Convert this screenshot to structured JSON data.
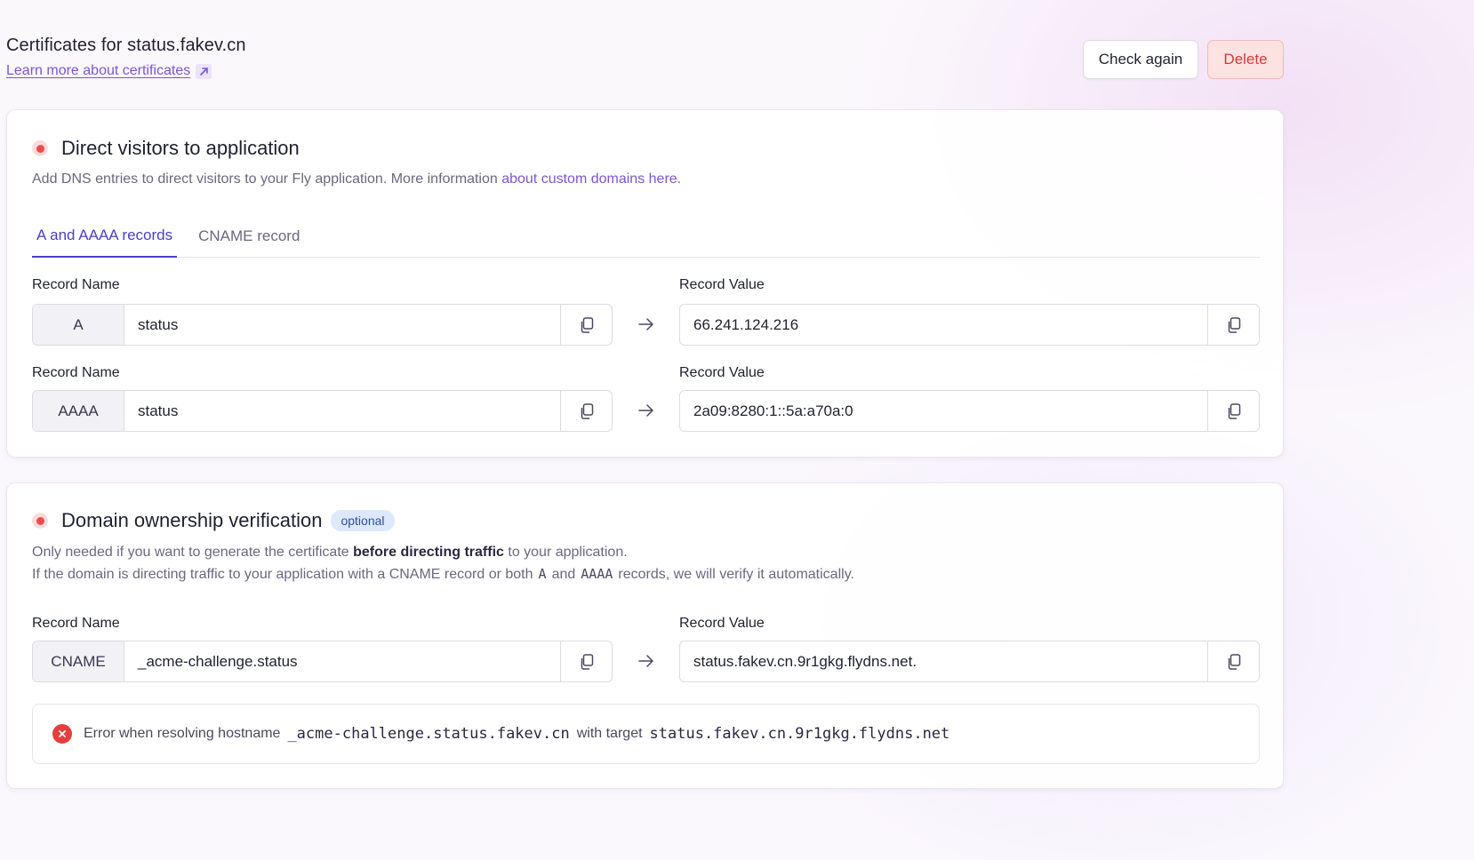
{
  "header": {
    "title": "Certificates for status.fakev.cn",
    "learn_more": "Learn more about certificates",
    "check_again": "Check again",
    "delete": "Delete"
  },
  "direct": {
    "title": "Direct visitors to application",
    "desc_prefix": "Add DNS entries to direct visitors to your Fly application. More information ",
    "desc_link": "about custom domains here",
    "desc_suffix": ".",
    "tabs": [
      {
        "label": "A and AAAA records",
        "active": true
      },
      {
        "label": "CNAME record",
        "active": false
      }
    ],
    "records": [
      {
        "name_label": "Record Name",
        "type": "A",
        "name": "status",
        "value_label": "Record Value",
        "value": "66.241.124.216"
      },
      {
        "name_label": "Record Name",
        "type": "AAAA",
        "name": "status",
        "value_label": "Record Value",
        "value": "2a09:8280:1::5a:a70a:0"
      }
    ]
  },
  "ownership": {
    "title": "Domain ownership verification",
    "badge": "optional",
    "line1_prefix": "Only needed if you want to generate the certificate ",
    "line1_bold": "before directing traffic",
    "line1_suffix": " to your application.",
    "line2_prefix": "If the domain is directing traffic to your application with a CNAME record or both",
    "line2_code1": "A",
    "line2_and": "and",
    "line2_code2": "AAAA",
    "line2_suffix": "records, we will verify it automatically.",
    "record": {
      "name_label": "Record Name",
      "type": "CNAME",
      "name": "_acme-challenge.status",
      "value_label": "Record Value",
      "value": "status.fakev.cn.9r1gkg.flydns.net."
    },
    "error": {
      "prefix": "Error when resolving hostname",
      "hostname": "_acme-challenge.status.fakev.cn",
      "middle": "with target",
      "target": "status.fakev.cn.9r1gkg.flydns.net"
    }
  },
  "colors": {
    "accent": "#4a3fc9",
    "link": "#7b55d6",
    "error": "#e53e3e",
    "status_dot": "#ef4b4b"
  },
  "icons": [
    "external-link-icon",
    "status-dot-icon",
    "copy-icon",
    "arrow-right-icon",
    "error-x-icon"
  ]
}
